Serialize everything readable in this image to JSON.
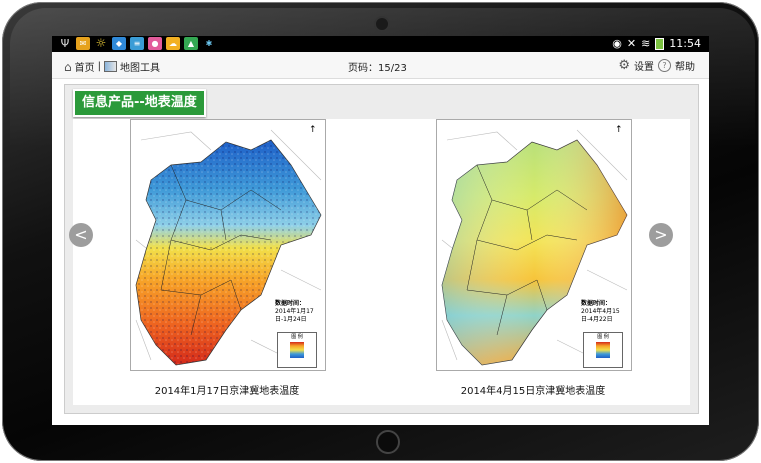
{
  "status_bar": {
    "time": "11:54"
  },
  "toolbar": {
    "home_label": "首页",
    "separator": "|",
    "map_tools_label": "地图工具",
    "page_label": "页码：15/23",
    "settings_label": "设置",
    "help_label": "帮助"
  },
  "panel": {
    "title": "信息产品--地表温度",
    "prev_label": "<",
    "next_label": ">",
    "maps": [
      {
        "caption": "2014年1月17日京津冀地表温度",
        "data_time_label": "数据时间：",
        "data_time_value": "2014年1月17日-1月24日",
        "legend_title": "图 例"
      },
      {
        "caption": "2014年4月15日京津冀地表温度",
        "data_time_label": "数据时间：",
        "data_time_value": "2014年4月15日-4月22日",
        "legend_title": "图 例"
      }
    ]
  }
}
